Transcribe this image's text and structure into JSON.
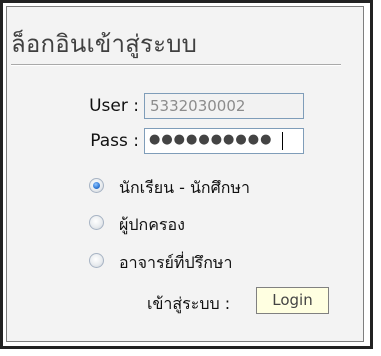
{
  "form": {
    "title": "ล็อกอินเข้าสู่ระบบ",
    "user_label": "User :",
    "user_value": "5332030002",
    "pass_label": "Pass :",
    "pass_value": "●●●●●●●●●●",
    "roles": [
      {
        "label": "นักเรียน - นักศึกษา",
        "checked": true
      },
      {
        "label": "ผู้ปกครอง",
        "checked": false
      },
      {
        "label": "อาจารย์ที่ปรึกษา",
        "checked": false
      }
    ],
    "enter_label": "เข้าสู่ระบบ :",
    "login_label": "Login"
  }
}
